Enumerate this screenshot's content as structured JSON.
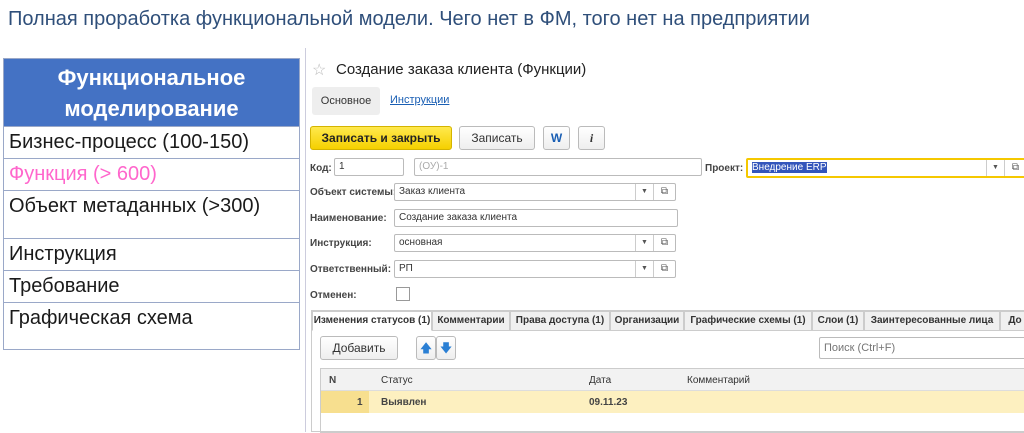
{
  "slide_title": "Полная проработка функциональной модели. Чего нет в ФМ, того нет на предприятии",
  "table": {
    "header": [
      "Функциональное",
      "моделирование"
    ],
    "rows": [
      {
        "label": "Бизнес-процесс (100-150)"
      },
      {
        "label": "Функция (> 600)"
      },
      {
        "label": "Объект метаданных (>300)"
      },
      {
        "label": "Инструкция"
      },
      {
        "label": "Требование"
      },
      {
        "label": "Графическая схема"
      }
    ],
    "highlight_color": "#ff66cc"
  },
  "form": {
    "title": "Создание заказа клиента (Функции)",
    "tabs": [
      "Основное",
      "Инструкции"
    ],
    "buttons": {
      "save_close": "Записать и закрыть",
      "save": "Записать",
      "word": "W",
      "info": "i"
    },
    "fields": {
      "code_label": "Код:",
      "code": "1",
      "code2": "(ОУ)-1",
      "project_label": "Проект:",
      "project": "Внедрение ERP",
      "object_label": "Объект системы:",
      "object": "Заказ клиента",
      "name_label": "Наименование:",
      "name": "Создание заказа клиента",
      "instr_label": "Инструкция:",
      "instr": "основная",
      "resp_label": "Ответственный:",
      "resp": "РП",
      "cancel_label": "Отменен:"
    },
    "subtabs": [
      "Изменения статусов (1)",
      "Комментарии",
      "Права доступа (1)",
      "Организации",
      "Графические схемы (1)",
      "Слои (1)",
      "Заинтересованные лица",
      "До"
    ],
    "add": "Добавить",
    "search_placeholder": "Поиск (Ctrl+F)",
    "grid": {
      "columns": [
        "N",
        "Статус",
        "Дата",
        "Комментарий"
      ],
      "rows": [
        {
          "n": "1",
          "status": "Выявлен",
          "date": "09.11.23",
          "comment": ""
        }
      ]
    }
  }
}
